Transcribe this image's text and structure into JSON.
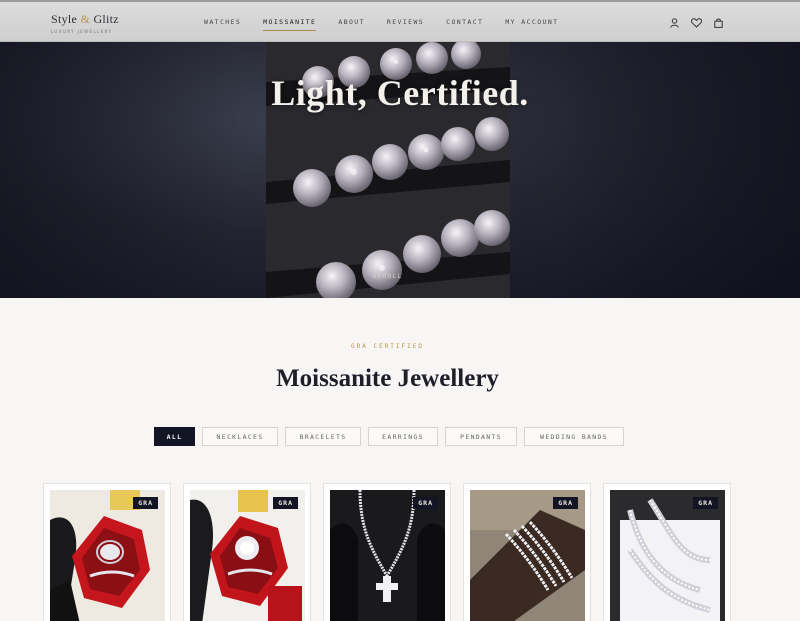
{
  "brand": {
    "name_part1": "Style",
    "amp": "&",
    "name_part2": "Glitz",
    "tagline": "LUXURY JEWELLERY"
  },
  "nav": {
    "items": [
      "WATCHES",
      "MOISSANITE",
      "ABOUT",
      "REVIEWS",
      "CONTACT",
      "MY ACCOUNT"
    ],
    "active": "MOISSANITE"
  },
  "header_icons": [
    "user-icon",
    "heart-icon",
    "bag-icon"
  ],
  "hero": {
    "title": "Light, Certified.",
    "scroll_label": "SCROLL"
  },
  "section": {
    "eyebrow": "GRA CERTIFIED",
    "title": "Moissanite Jewellery"
  },
  "filters": {
    "items": [
      "ALL",
      "NECKLACES",
      "BRACELETS",
      "EARRINGS",
      "PENDANTS",
      "WEDDING BANDS"
    ],
    "active": "ALL"
  },
  "products": [
    {
      "badge": "GRA",
      "image": "ring-in-red-box"
    },
    {
      "badge": "GRA",
      "image": "halo-ring-in-red-box"
    },
    {
      "badge": "GRA",
      "image": "cross-pendant-necklace"
    },
    {
      "badge": "GRA",
      "image": "tennis-bracelets-on-wrist"
    },
    {
      "badge": "GRA",
      "image": "cuban-chain-in-box"
    }
  ],
  "colors": {
    "accent_gold": "#b89545",
    "dark_navy": "#131424",
    "background": "#f8f6f4",
    "header_gray": "#d6d6d6"
  }
}
